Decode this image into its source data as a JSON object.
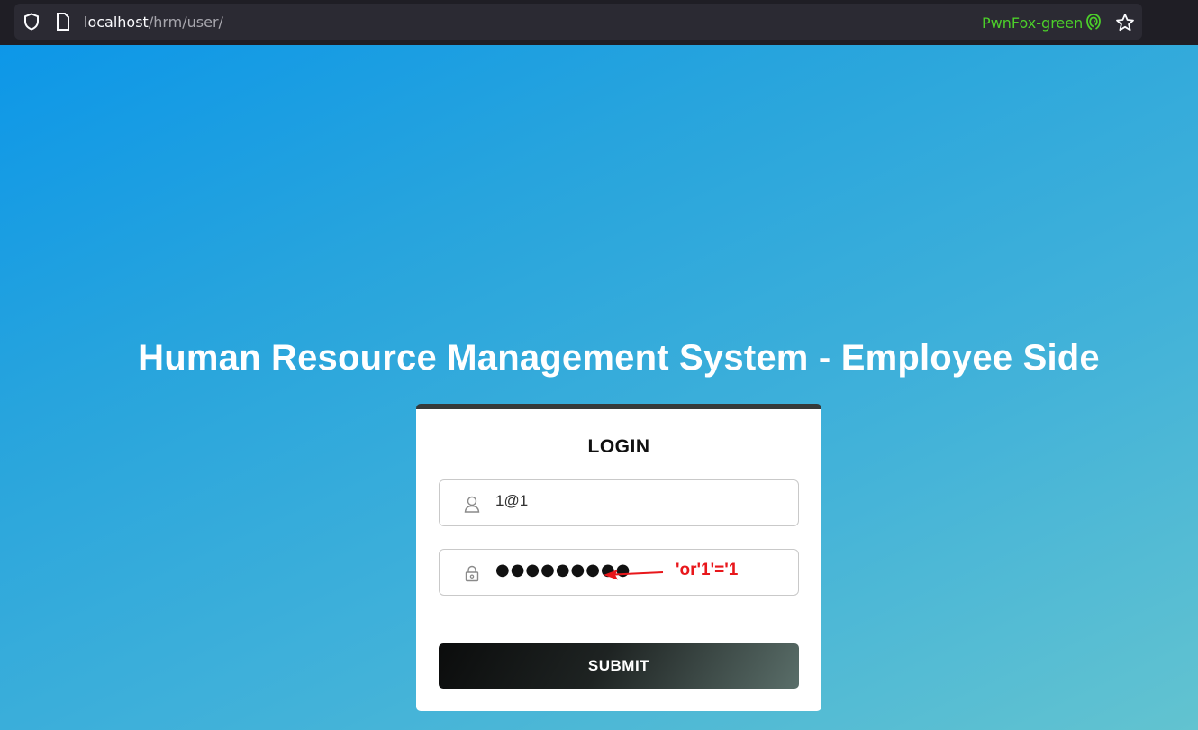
{
  "browser": {
    "url_host": "localhost",
    "url_path": "/hrm/user/",
    "container_label": "PwnFox-green",
    "icons": [
      "shield-icon",
      "page-icon",
      "fingerprint-icon",
      "star-icon"
    ],
    "container_color": "#4ccf2a"
  },
  "page": {
    "title": "Human Resource Management System - Employee Side",
    "background_colors": [
      "#0d97e8",
      "#62c3d0"
    ]
  },
  "login": {
    "heading": "LOGIN",
    "email_value": "1@1",
    "password_masked": "●●●●●●●●●",
    "annotation": "'or'1'='1",
    "annotation_color": "#e8171b",
    "submit_label": "SUBMIT",
    "icons": [
      "user-icon",
      "lock-icon"
    ]
  }
}
